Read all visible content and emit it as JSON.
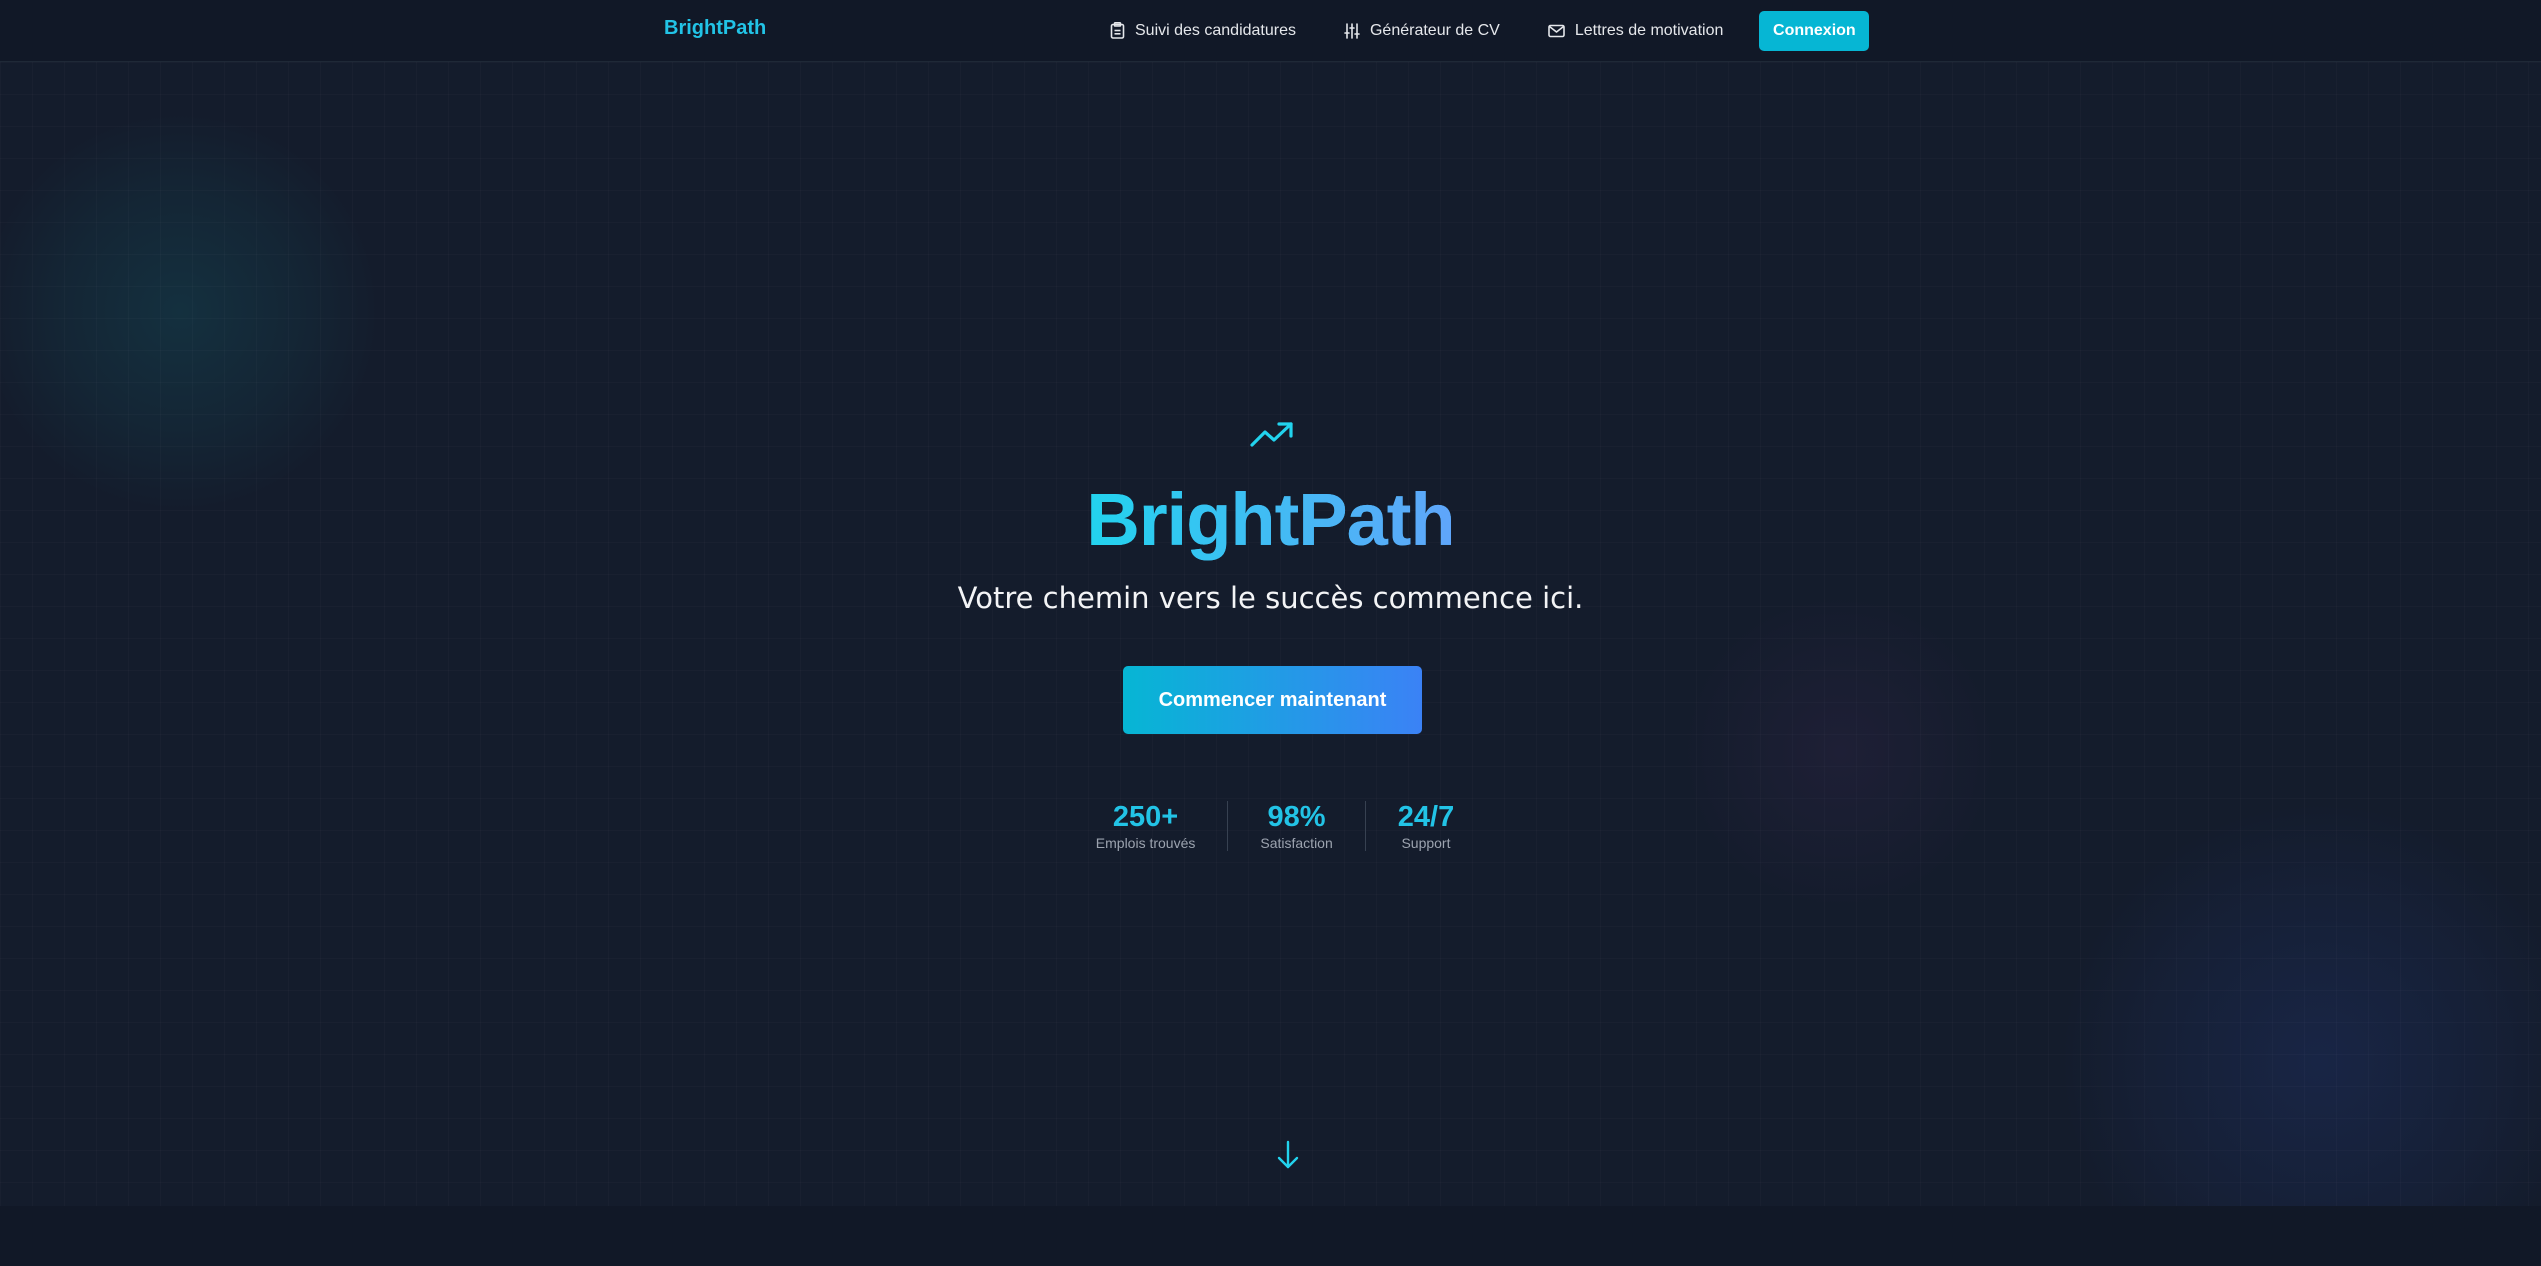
{
  "nav": {
    "brand": "BrightPath",
    "links": [
      {
        "label": "Suivi des candidatures",
        "icon": "clipboard-icon"
      },
      {
        "label": "Générateur de CV",
        "icon": "sliders-icon"
      },
      {
        "label": "Lettres de motivation",
        "icon": "mail-icon"
      }
    ],
    "login_label": "Connexion"
  },
  "hero": {
    "icon": "trending-up-icon",
    "title": "BrightPath",
    "tagline": "Votre chemin vers le succès commence ici.",
    "cta_label": "Commencer maintenant",
    "stats": [
      {
        "value": "250+",
        "label": "Emplois trouvés"
      },
      {
        "value": "98%",
        "label": "Satisfaction"
      },
      {
        "value": "24/7",
        "label": "Support"
      }
    ],
    "scroll_icon": "arrow-down-icon"
  },
  "colors": {
    "accent": "#22c3e6",
    "accent_gradient_end": "#3b82f6",
    "background": "#141c2c",
    "nav_background": "#111827"
  }
}
